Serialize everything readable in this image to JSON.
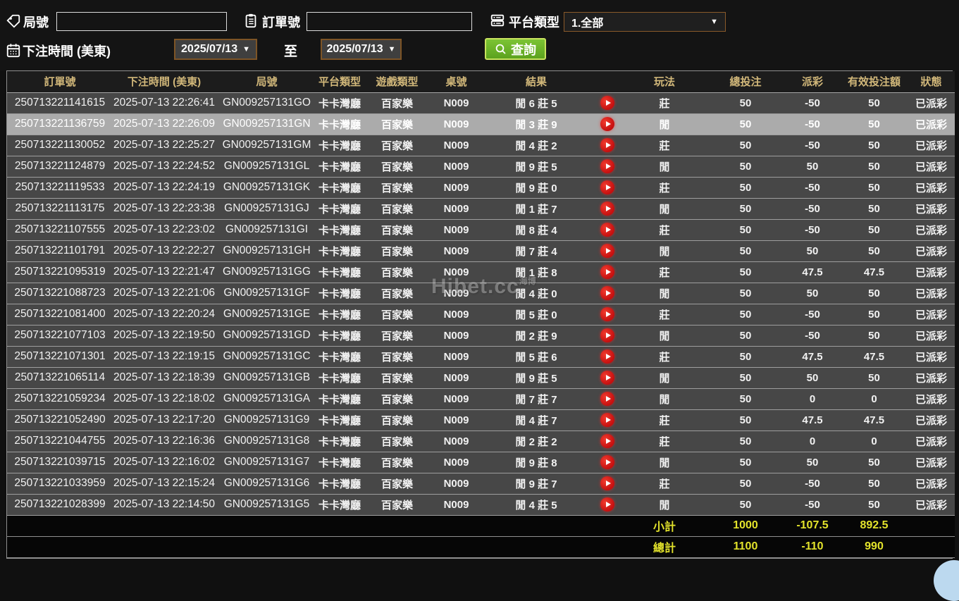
{
  "filters": {
    "game_no_label": "局號",
    "order_no_label": "訂單號",
    "platform_label": "平台類型",
    "platform_value": "1.全部",
    "bet_time_label": "下注時間 (美東)",
    "to_label": "至",
    "date_from": "2025/07/13",
    "date_to": "2025/07/13",
    "query_label": "查詢",
    "game_no_value": "",
    "order_no_value": ""
  },
  "watermark": {
    "text": "Hibet.cc",
    "cn": "海博"
  },
  "colors": {
    "header_gold": "#d2b87a",
    "total_yellow": "#e3e32b",
    "win_green": "#55cb25",
    "loss_red": "#8e2133",
    "loss_red_selected": "#d2364a",
    "status_green": "#2ed32e",
    "accent_green": "#6ab52c"
  },
  "table": {
    "headers": [
      "訂單號",
      "下注時間 (美東)",
      "局號",
      "平台類型",
      "遊戲類型",
      "桌號",
      "結果",
      "",
      "玩法",
      "總投注",
      "派彩",
      "有效投注額",
      "狀態"
    ],
    "columns": [
      "order_no",
      "bet_time",
      "game_no",
      "platform",
      "game_type",
      "table_no",
      "result",
      "play",
      "play_type",
      "total_bet",
      "payout",
      "valid_bet",
      "status"
    ],
    "rows": [
      {
        "order_no": "250713221141615",
        "bet_time": "2025-07-13 22:26:41",
        "game_no": "GN009257131GO",
        "platform": "卡卡灣廳",
        "game_type": "百家樂",
        "table_no": "N009",
        "result": "閒 6 莊 5",
        "play_type": "莊",
        "total_bet": "50",
        "payout": "-50",
        "payout_class": "loss",
        "valid_bet": "50",
        "status": "已派彩",
        "selected": false
      },
      {
        "order_no": "250713221136759",
        "bet_time": "2025-07-13 22:26:09",
        "game_no": "GN009257131GN",
        "platform": "卡卡灣廳",
        "game_type": "百家樂",
        "table_no": "N009",
        "result": "閒 3 莊 9",
        "play_type": "閒",
        "total_bet": "50",
        "payout": "-50",
        "payout_class": "loss",
        "valid_bet": "50",
        "status": "已派彩",
        "selected": true
      },
      {
        "order_no": "250713221130052",
        "bet_time": "2025-07-13 22:25:27",
        "game_no": "GN009257131GM",
        "platform": "卡卡灣廳",
        "game_type": "百家樂",
        "table_no": "N009",
        "result": "閒 4 莊 2",
        "play_type": "莊",
        "total_bet": "50",
        "payout": "-50",
        "payout_class": "loss",
        "valid_bet": "50",
        "status": "已派彩",
        "selected": false
      },
      {
        "order_no": "250713221124879",
        "bet_time": "2025-07-13 22:24:52",
        "game_no": "GN009257131GL",
        "platform": "卡卡灣廳",
        "game_type": "百家樂",
        "table_no": "N009",
        "result": "閒 9 莊 5",
        "play_type": "閒",
        "total_bet": "50",
        "payout": "50",
        "payout_class": "win",
        "valid_bet": "50",
        "status": "已派彩",
        "selected": false
      },
      {
        "order_no": "250713221119533",
        "bet_time": "2025-07-13 22:24:19",
        "game_no": "GN009257131GK",
        "platform": "卡卡灣廳",
        "game_type": "百家樂",
        "table_no": "N009",
        "result": "閒 9 莊 0",
        "play_type": "莊",
        "total_bet": "50",
        "payout": "-50",
        "payout_class": "loss",
        "valid_bet": "50",
        "status": "已派彩",
        "selected": false
      },
      {
        "order_no": "250713221113175",
        "bet_time": "2025-07-13 22:23:38",
        "game_no": "GN009257131GJ",
        "platform": "卡卡灣廳",
        "game_type": "百家樂",
        "table_no": "N009",
        "result": "閒 1 莊 7",
        "play_type": "閒",
        "total_bet": "50",
        "payout": "-50",
        "payout_class": "loss",
        "valid_bet": "50",
        "status": "已派彩",
        "selected": false
      },
      {
        "order_no": "250713221107555",
        "bet_time": "2025-07-13 22:23:02",
        "game_no": "GN009257131GI",
        "platform": "卡卡灣廳",
        "game_type": "百家樂",
        "table_no": "N009",
        "result": "閒 8 莊 4",
        "play_type": "莊",
        "total_bet": "50",
        "payout": "-50",
        "payout_class": "loss",
        "valid_bet": "50",
        "status": "已派彩",
        "selected": false
      },
      {
        "order_no": "250713221101791",
        "bet_time": "2025-07-13 22:22:27",
        "game_no": "GN009257131GH",
        "platform": "卡卡灣廳",
        "game_type": "百家樂",
        "table_no": "N009",
        "result": "閒 7 莊 4",
        "play_type": "閒",
        "total_bet": "50",
        "payout": "50",
        "payout_class": "win",
        "valid_bet": "50",
        "status": "已派彩",
        "selected": false
      },
      {
        "order_no": "250713221095319",
        "bet_time": "2025-07-13 22:21:47",
        "game_no": "GN009257131GG",
        "platform": "卡卡灣廳",
        "game_type": "百家樂",
        "table_no": "N009",
        "result": "閒 1 莊 8",
        "play_type": "莊",
        "total_bet": "50",
        "payout": "47.5",
        "payout_class": "win",
        "valid_bet": "47.5",
        "status": "已派彩",
        "selected": false
      },
      {
        "order_no": "250713221088723",
        "bet_time": "2025-07-13 22:21:06",
        "game_no": "GN009257131GF",
        "platform": "卡卡灣廳",
        "game_type": "百家樂",
        "table_no": "N009",
        "result": "閒 4 莊 0",
        "play_type": "閒",
        "total_bet": "50",
        "payout": "50",
        "payout_class": "win",
        "valid_bet": "50",
        "status": "已派彩",
        "selected": false
      },
      {
        "order_no": "250713221081400",
        "bet_time": "2025-07-13 22:20:24",
        "game_no": "GN009257131GE",
        "platform": "卡卡灣廳",
        "game_type": "百家樂",
        "table_no": "N009",
        "result": "閒 5 莊 0",
        "play_type": "莊",
        "total_bet": "50",
        "payout": "-50",
        "payout_class": "loss",
        "valid_bet": "50",
        "status": "已派彩",
        "selected": false
      },
      {
        "order_no": "250713221077103",
        "bet_time": "2025-07-13 22:19:50",
        "game_no": "GN009257131GD",
        "platform": "卡卡灣廳",
        "game_type": "百家樂",
        "table_no": "N009",
        "result": "閒 2 莊 9",
        "play_type": "閒",
        "total_bet": "50",
        "payout": "-50",
        "payout_class": "loss",
        "valid_bet": "50",
        "status": "已派彩",
        "selected": false
      },
      {
        "order_no": "250713221071301",
        "bet_time": "2025-07-13 22:19:15",
        "game_no": "GN009257131GC",
        "platform": "卡卡灣廳",
        "game_type": "百家樂",
        "table_no": "N009",
        "result": "閒 5 莊 6",
        "play_type": "莊",
        "total_bet": "50",
        "payout": "47.5",
        "payout_class": "win",
        "valid_bet": "47.5",
        "status": "已派彩",
        "selected": false
      },
      {
        "order_no": "250713221065114",
        "bet_time": "2025-07-13 22:18:39",
        "game_no": "GN009257131GB",
        "platform": "卡卡灣廳",
        "game_type": "百家樂",
        "table_no": "N009",
        "result": "閒 9 莊 5",
        "play_type": "閒",
        "total_bet": "50",
        "payout": "50",
        "payout_class": "win",
        "valid_bet": "50",
        "status": "已派彩",
        "selected": false
      },
      {
        "order_no": "250713221059234",
        "bet_time": "2025-07-13 22:18:02",
        "game_no": "GN009257131GA",
        "platform": "卡卡灣廳",
        "game_type": "百家樂",
        "table_no": "N009",
        "result": "閒 7 莊 7",
        "play_type": "閒",
        "total_bet": "50",
        "payout": "0",
        "payout_class": "zero",
        "valid_bet": "0",
        "status": "已派彩",
        "selected": false
      },
      {
        "order_no": "250713221052490",
        "bet_time": "2025-07-13 22:17:20",
        "game_no": "GN009257131G9",
        "platform": "卡卡灣廳",
        "game_type": "百家樂",
        "table_no": "N009",
        "result": "閒 4 莊 7",
        "play_type": "莊",
        "total_bet": "50",
        "payout": "47.5",
        "payout_class": "win",
        "valid_bet": "47.5",
        "status": "已派彩",
        "selected": false
      },
      {
        "order_no": "250713221044755",
        "bet_time": "2025-07-13 22:16:36",
        "game_no": "GN009257131G8",
        "platform": "卡卡灣廳",
        "game_type": "百家樂",
        "table_no": "N009",
        "result": "閒 2 莊 2",
        "play_type": "莊",
        "total_bet": "50",
        "payout": "0",
        "payout_class": "zero",
        "valid_bet": "0",
        "status": "已派彩",
        "selected": false
      },
      {
        "order_no": "250713221039715",
        "bet_time": "2025-07-13 22:16:02",
        "game_no": "GN009257131G7",
        "platform": "卡卡灣廳",
        "game_type": "百家樂",
        "table_no": "N009",
        "result": "閒 9 莊 8",
        "play_type": "閒",
        "total_bet": "50",
        "payout": "50",
        "payout_class": "win",
        "valid_bet": "50",
        "status": "已派彩",
        "selected": false
      },
      {
        "order_no": "250713221033959",
        "bet_time": "2025-07-13 22:15:24",
        "game_no": "GN009257131G6",
        "platform": "卡卡灣廳",
        "game_type": "百家樂",
        "table_no": "N009",
        "result": "閒 9 莊 7",
        "play_type": "莊",
        "total_bet": "50",
        "payout": "-50",
        "payout_class": "loss",
        "valid_bet": "50",
        "status": "已派彩",
        "selected": false
      },
      {
        "order_no": "250713221028399",
        "bet_time": "2025-07-13 22:14:50",
        "game_no": "GN009257131G5",
        "platform": "卡卡灣廳",
        "game_type": "百家樂",
        "table_no": "N009",
        "result": "閒 4 莊 5",
        "play_type": "閒",
        "total_bet": "50",
        "payout": "-50",
        "payout_class": "loss",
        "valid_bet": "50",
        "status": "已派彩",
        "selected": false
      }
    ],
    "totals": [
      {
        "label": "小計",
        "total_bet": "1000",
        "payout": "-107.5",
        "valid_bet": "892.5"
      },
      {
        "label": "總計",
        "total_bet": "1100",
        "payout": "-110",
        "valid_bet": "990"
      }
    ]
  }
}
